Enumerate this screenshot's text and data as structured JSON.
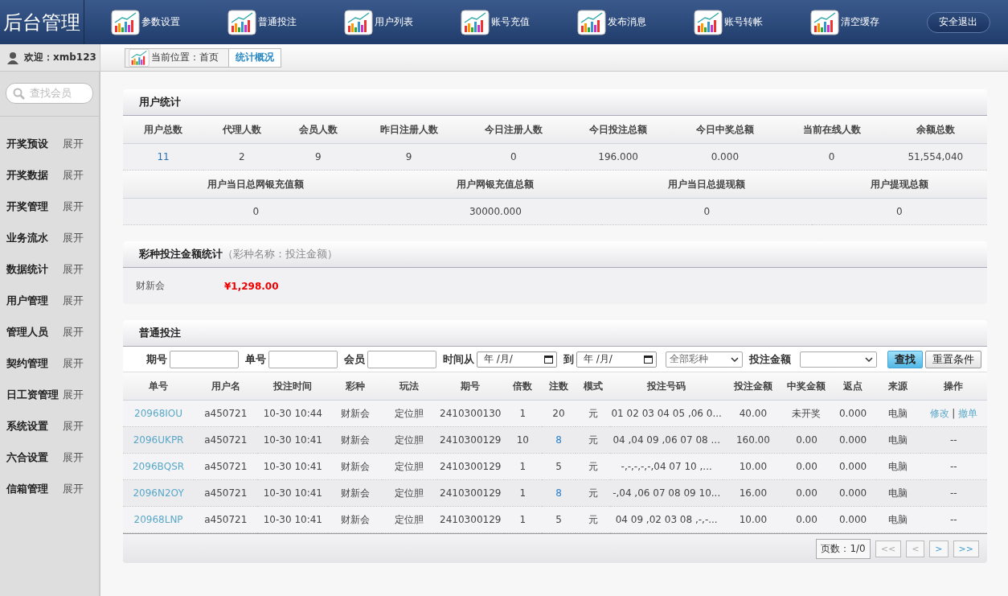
{
  "header": {
    "title": "后台管理",
    "nav": [
      {
        "label": "参数设置"
      },
      {
        "label": "普通投注"
      },
      {
        "label": "用户列表"
      },
      {
        "label": "账号充值"
      },
      {
        "label": "发布消息"
      },
      {
        "label": "账号转帐"
      },
      {
        "label": "清空缓存"
      }
    ],
    "logout": "安全退出"
  },
  "welcome": "欢迎：xmb123",
  "breadcrumb": {
    "location": "当前位置：首页",
    "current": "统计概况"
  },
  "sidebar": {
    "search_placeholder": "查找会员",
    "items": [
      {
        "label": "开奖预设",
        "toggle": "展开"
      },
      {
        "label": "开奖数据",
        "toggle": "展开"
      },
      {
        "label": "开奖管理",
        "toggle": "展开"
      },
      {
        "label": "业务流水",
        "toggle": "展开"
      },
      {
        "label": "数据统计",
        "toggle": "展开"
      },
      {
        "label": "用户管理",
        "toggle": "展开"
      },
      {
        "label": "管理人员",
        "toggle": "展开"
      },
      {
        "label": "契约管理",
        "toggle": "展开"
      },
      {
        "label": "日工资管理",
        "toggle": "展开"
      },
      {
        "label": "系统设置",
        "toggle": "展开"
      },
      {
        "label": "六合设置",
        "toggle": "展开"
      },
      {
        "label": "信箱管理",
        "toggle": "展开"
      }
    ]
  },
  "user_stats": {
    "title": "用户统计",
    "groups": [
      {
        "columns": [
          "用户总数",
          "代理人数",
          "会员人数",
          "昨日注册人数",
          "今日注册人数",
          "今日投注总额",
          "今日中奖总额",
          "当前在线人数",
          "余额总数"
        ],
        "values": [
          "11",
          "2",
          "9",
          "9",
          "0",
          "196.000",
          "0.000",
          "0",
          "51,554,040"
        ]
      },
      {
        "columns": [
          "用户当日总网银充值额",
          "用户网银充值总额",
          "用户当日总提现额",
          "用户提现总额"
        ],
        "values": [
          "0",
          "30000.000",
          "0",
          "0"
        ]
      }
    ]
  },
  "lottery_stats": {
    "title": "彩种投注金额统计",
    "hint": "（彩种名称：投注金额）",
    "items": [
      {
        "name": "财新会",
        "amount": "¥1,298.00"
      }
    ]
  },
  "bets": {
    "title": "普通投注",
    "filters": [
      {
        "kind": "text",
        "label": "期号"
      },
      {
        "kind": "text",
        "label": "单号"
      },
      {
        "kind": "text",
        "label": "会员"
      },
      {
        "kind": "date",
        "label": "时间从",
        "placeholder": "年 /月/"
      },
      {
        "kind": "date",
        "label": "到",
        "placeholder": "年 /月/"
      },
      {
        "kind": "select",
        "value": "全部彩种"
      },
      {
        "kind": "select",
        "label": "投注金额"
      }
    ],
    "buttons": [
      {
        "label": "查找",
        "primary": true
      },
      {
        "label": "重置条件",
        "primary": false
      }
    ],
    "columns": [
      "单号",
      "用户名",
      "投注时间",
      "彩种",
      "玩法",
      "期号",
      "倍数",
      "注数",
      "模式",
      "投注号码",
      "投注金额",
      "中奖金额",
      "返点",
      "来源",
      "操作"
    ],
    "action_separator": "|",
    "rows": [
      {
        "id": "20968IOU",
        "user": "a450721",
        "time": "10-30 10:44",
        "lottery": "财新会",
        "play": "定位胆",
        "issue": "2410300130",
        "multiple": "1",
        "count": "20",
        "count_highlight": false,
        "mode": "元",
        "numbers": "01 02 03 04 05 ,06 0...",
        "amount": "40.00",
        "prize": "未开奖",
        "rebate": "0.000",
        "source": "电脑",
        "actions": [
          {
            "label": "修改"
          },
          {
            "label": "撤单"
          }
        ]
      },
      {
        "id": "2096UKPR",
        "user": "a450721",
        "time": "10-30 10:41",
        "lottery": "财新会",
        "play": "定位胆",
        "issue": "2410300129",
        "multiple": "10",
        "count": "8",
        "count_highlight": true,
        "mode": "元",
        "numbers": "04 ,04 09 ,06 07 08 ...",
        "amount": "160.00",
        "prize": "0.00",
        "rebate": "0.000",
        "source": "电脑",
        "action_text": "--"
      },
      {
        "id": "2096BQSR",
        "user": "a450721",
        "time": "10-30 10:41",
        "lottery": "财新会",
        "play": "定位胆",
        "issue": "2410300129",
        "multiple": "1",
        "count": "5",
        "count_highlight": false,
        "mode": "元",
        "numbers": "-,-,-,-,-,04 07 10 ,...",
        "amount": "10.00",
        "prize": "0.00",
        "rebate": "0.000",
        "source": "电脑",
        "action_text": "--"
      },
      {
        "id": "2096N2OY",
        "user": "a450721",
        "time": "10-30 10:41",
        "lottery": "财新会",
        "play": "定位胆",
        "issue": "2410300129",
        "multiple": "1",
        "count": "8",
        "count_highlight": true,
        "mode": "元",
        "numbers": "-,04 ,06 07 08 09 10...",
        "amount": "16.00",
        "prize": "0.00",
        "rebate": "0.000",
        "source": "电脑",
        "action_text": "--"
      },
      {
        "id": "20968LNP",
        "user": "a450721",
        "time": "10-30 10:41",
        "lottery": "财新会",
        "play": "定位胆",
        "issue": "2410300129",
        "multiple": "1",
        "count": "5",
        "count_highlight": false,
        "mode": "元",
        "numbers": "04 09 ,02 03 08 ,-,-...",
        "amount": "10.00",
        "prize": "0.00",
        "rebate": "0.000",
        "source": "电脑",
        "action_text": "--"
      }
    ],
    "pagination": {
      "pages": "页数：1/0",
      "buttons": [
        {
          "label": "<<",
          "disabled": true
        },
        {
          "label": "<",
          "disabled": true
        },
        {
          "label": ">",
          "disabled": false
        },
        {
          "label": ">>",
          "disabled": false
        }
      ]
    }
  }
}
